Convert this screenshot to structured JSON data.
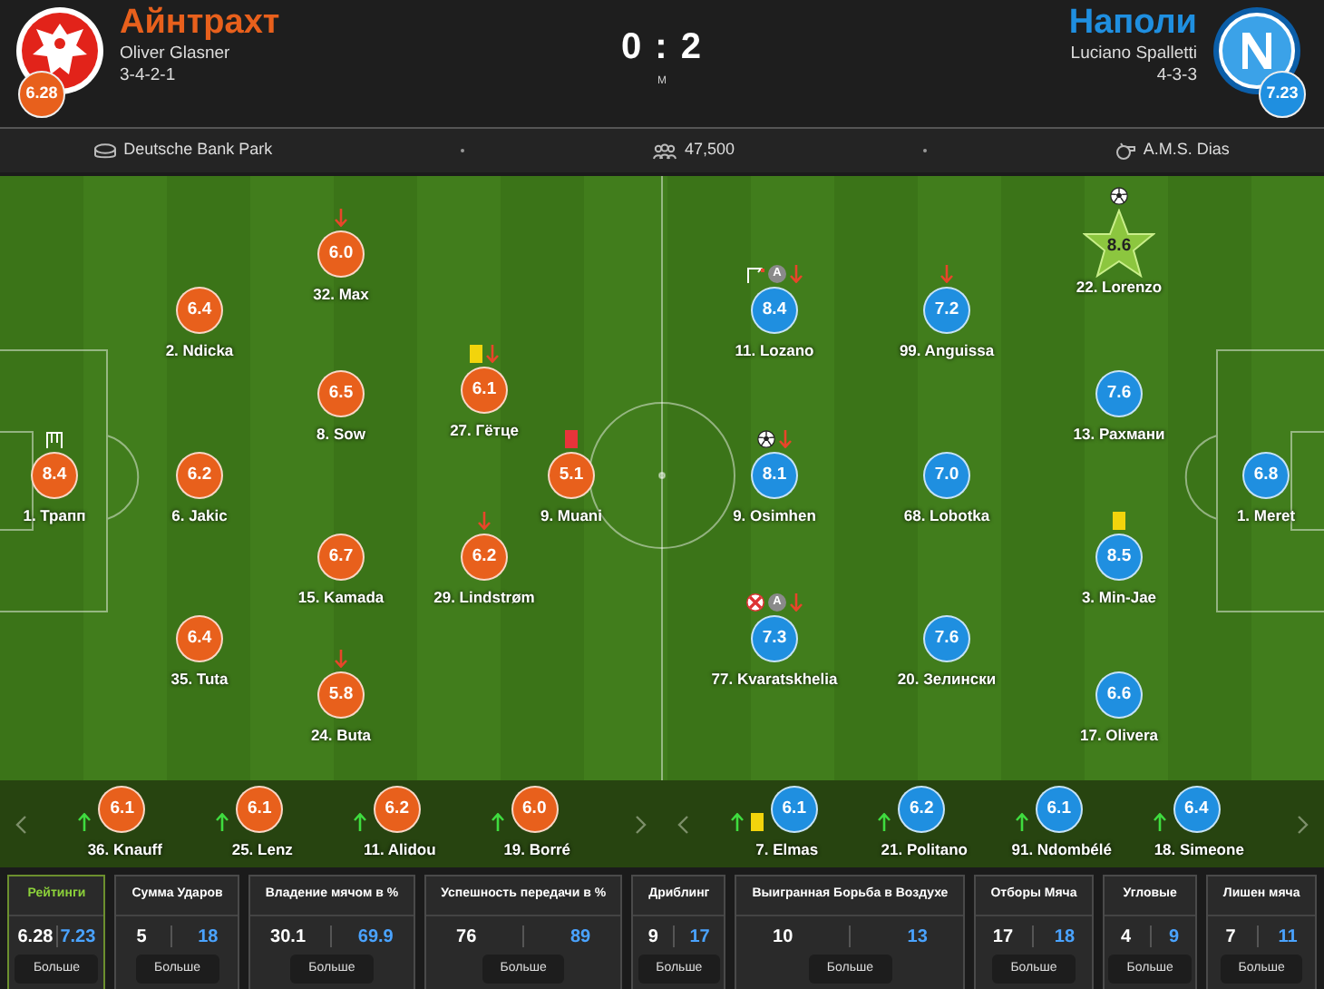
{
  "match": {
    "score": "0 : 2",
    "status": "М"
  },
  "teams": [
    {
      "name": "Айнтрахт",
      "manager": "Oliver Glasner",
      "formation": "3-4-2-1",
      "rating": "6.28",
      "color": "#e8601c",
      "lines": [
        [
          {
            "label": "1. Трапп",
            "rating": "8.4",
            "motm": false,
            "events": [
              {
                "kind": "save"
              }
            ]
          }
        ],
        [
          {
            "label": "2. Ndicka",
            "rating": "6.4",
            "motm": false
          },
          {
            "label": "6. Jakic",
            "rating": "6.2",
            "motm": false
          },
          {
            "label": "35. Tuta",
            "rating": "6.4",
            "motm": false
          }
        ],
        [
          {
            "label": "32. Max",
            "rating": "6.0",
            "motm": false,
            "events": [
              {
                "kind": "sub_off"
              }
            ]
          },
          {
            "label": "8. Sow",
            "rating": "6.5",
            "motm": false
          },
          {
            "label": "15. Kamada",
            "rating": "6.7",
            "motm": false
          },
          {
            "label": "24. Buta",
            "rating": "5.8",
            "motm": false,
            "events": [
              {
                "kind": "sub_off"
              }
            ]
          }
        ],
        [
          {
            "label": "27. Гётце",
            "rating": "6.1",
            "motm": false,
            "events": [
              {
                "kind": "yellow_card"
              },
              {
                "kind": "sub_off"
              }
            ]
          },
          {
            "label": "29. Lindstrøm",
            "rating": "6.2",
            "motm": false,
            "events": [
              {
                "kind": "sub_off"
              }
            ]
          }
        ],
        [
          {
            "label": "9. Muani",
            "rating": "5.1",
            "motm": false,
            "events": [
              {
                "kind": "red_card"
              }
            ]
          }
        ]
      ],
      "bench": [
        {
          "label": "36. Knauff",
          "rating": "6.1",
          "events": [
            {
              "kind": "sub_on"
            }
          ]
        },
        {
          "label": "25. Lenz",
          "rating": "6.1",
          "events": [
            {
              "kind": "sub_on"
            }
          ]
        },
        {
          "label": "11. Alidou",
          "rating": "6.2",
          "events": [
            {
              "kind": "sub_on"
            }
          ]
        },
        {
          "label": "19. Borré",
          "rating": "6.0",
          "events": [
            {
              "kind": "sub_on"
            }
          ]
        }
      ]
    },
    {
      "name": "Наполи",
      "manager": "Luciano Spalletti",
      "formation": "4-3-3",
      "rating": "7.23",
      "color": "#1f8fe0",
      "lines": [
        [
          {
            "label": "11. Lozano",
            "rating": "8.4",
            "motm": false,
            "events": [
              {
                "kind": "corner"
              },
              {
                "kind": "assist",
                "label": "A"
              },
              {
                "kind": "sub_off"
              }
            ]
          },
          {
            "label": "9. Osimhen",
            "rating": "8.1",
            "motm": false,
            "events": [
              {
                "kind": "goal"
              },
              {
                "kind": "sub_off"
              }
            ]
          },
          {
            "label": "77. Kvaratskhelia",
            "rating": "7.3",
            "motm": false,
            "events": [
              {
                "kind": "penalty_missed"
              },
              {
                "kind": "assist",
                "label": "A"
              },
              {
                "kind": "sub_off"
              }
            ]
          }
        ],
        [
          {
            "label": "99. Anguissa",
            "rating": "7.2",
            "motm": false,
            "events": [
              {
                "kind": "sub_off"
              }
            ]
          },
          {
            "label": "68. Lobotka",
            "rating": "7.0",
            "motm": false
          },
          {
            "label": "20. Зелински",
            "rating": "7.6",
            "motm": false
          }
        ],
        [
          {
            "label": "22. Lorenzo",
            "rating": "8.6",
            "motm": true,
            "events": [
              {
                "kind": "goal"
              }
            ]
          },
          {
            "label": "13. Рахмани",
            "rating": "7.6",
            "motm": false
          },
          {
            "label": "3. Min-Jae",
            "rating": "8.5",
            "motm": false,
            "events": [
              {
                "kind": "yellow_card"
              }
            ]
          },
          {
            "label": "17. Olivera",
            "rating": "6.6",
            "motm": false
          }
        ],
        [
          {
            "label": "1. Meret",
            "rating": "6.8",
            "motm": false
          }
        ]
      ],
      "bench": [
        {
          "label": "7. Elmas",
          "rating": "6.1",
          "events": [
            {
              "kind": "sub_on"
            },
            {
              "kind": "yellow_card"
            }
          ]
        },
        {
          "label": "21. Politano",
          "rating": "6.2",
          "events": [
            {
              "kind": "sub_on"
            }
          ]
        },
        {
          "label": "91. Ndombélé",
          "rating": "6.1",
          "events": [
            {
              "kind": "sub_on"
            }
          ]
        },
        {
          "label": "18. Simeone",
          "rating": "6.4",
          "events": [
            {
              "kind": "sub_on"
            }
          ]
        }
      ]
    }
  ],
  "venue": {
    "stadium": "Deutsche Bank Park",
    "attendance": "47,500",
    "referee": "A.M.S. Dias"
  },
  "stats": [
    {
      "title": "Рейтинги",
      "home": "6.28",
      "away": "7.23",
      "button": "Больше",
      "selected": true
    },
    {
      "title": "Сумма Ударов",
      "home": "5",
      "away": "18",
      "button": "Больше",
      "selected": false
    },
    {
      "title": "Владение мячом в %",
      "home": "30.1",
      "away": "69.9",
      "button": "Больше",
      "selected": false
    },
    {
      "title": "Успешность передачи в %",
      "home": "76",
      "away": "89",
      "button": "Больше",
      "selected": false
    },
    {
      "title": "Дриблинг",
      "home": "9",
      "away": "17",
      "button": "Больше",
      "selected": false
    },
    {
      "title": "Выигранная Борьба в Воздухе",
      "home": "10",
      "away": "13",
      "button": "Больше",
      "selected": false
    },
    {
      "title": "Отборы Мяча",
      "home": "17",
      "away": "18",
      "button": "Больше",
      "selected": false
    },
    {
      "title": "Угловые",
      "home": "4",
      "away": "9",
      "button": "Больше",
      "selected": false
    },
    {
      "title": "Лишен мяча",
      "home": "7",
      "away": "11",
      "button": "Больше",
      "selected": false
    }
  ]
}
